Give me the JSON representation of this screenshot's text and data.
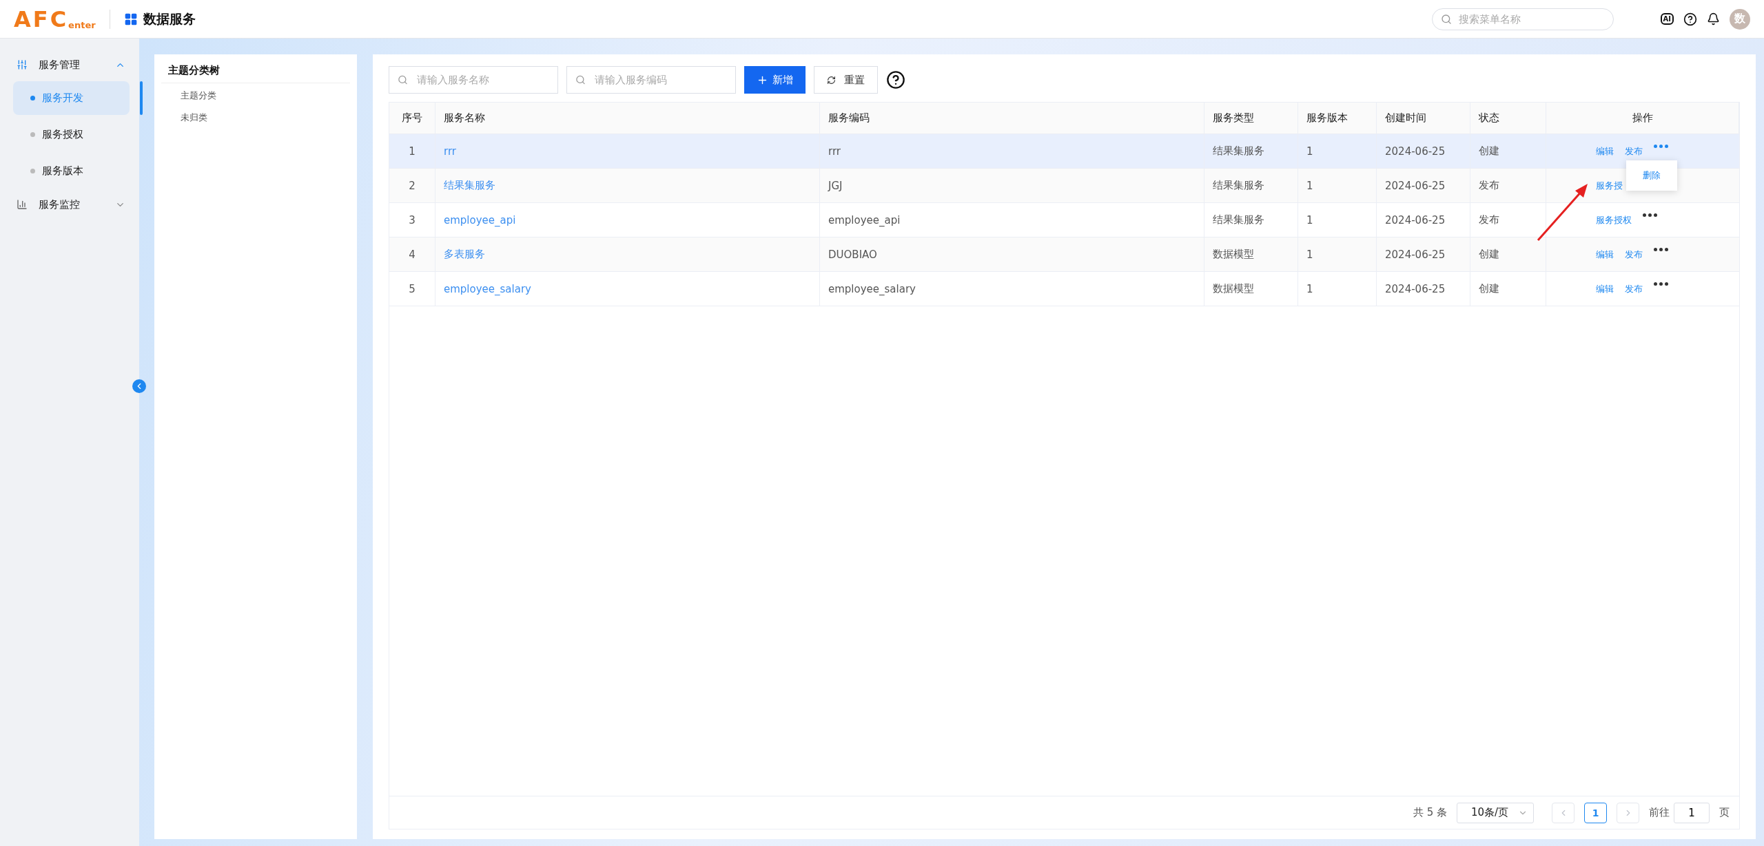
{
  "header": {
    "logo_main": "AFC",
    "logo_sub": "enter",
    "app_title": "数据服务",
    "search": {
      "placeholder": "搜索菜单名称"
    },
    "ai_badge": "AI",
    "avatar": "数"
  },
  "sidebar": {
    "items": [
      {
        "label": "服务管理",
        "expanded": true,
        "children": [
          {
            "label": "服务开发",
            "selected": true
          },
          {
            "label": "服务授权",
            "selected": false
          },
          {
            "label": "服务版本",
            "selected": false
          }
        ]
      },
      {
        "label": "服务监控",
        "expanded": false
      }
    ]
  },
  "tree": {
    "title": "主题分类树",
    "items": [
      {
        "label": "主题分类"
      },
      {
        "label": "未归类"
      }
    ]
  },
  "toolbar": {
    "name_search": {
      "placeholder": "请输入服务名称"
    },
    "code_search": {
      "placeholder": "请输入服务编码"
    },
    "add_button": "新增",
    "reset_button": "重置"
  },
  "table": {
    "columns": [
      "序号",
      "服务名称",
      "服务编码",
      "服务类型",
      "服务版本",
      "创建时间",
      "状态",
      "操作"
    ],
    "rows": [
      {
        "index": "1",
        "name": "rrr",
        "code": "rrr",
        "type": "结果集服务",
        "version": "1",
        "created": "2024-06-25",
        "status": "创建",
        "actions": [
          "编辑",
          "发布"
        ],
        "more_open": true,
        "hovered": true,
        "menu": [
          "删除"
        ]
      },
      {
        "index": "2",
        "name": "结果集服务",
        "code": "JGJ",
        "type": "结果集服务",
        "version": "1",
        "created": "2024-06-25",
        "status": "发布",
        "actions": [
          "服务授"
        ],
        "hovered": false
      },
      {
        "index": "3",
        "name": "employee_api",
        "code": "employee_api",
        "type": "结果集服务",
        "version": "1",
        "created": "2024-06-25",
        "status": "发布",
        "actions": [
          "服务授权"
        ],
        "more_open": false,
        "hovered": false
      },
      {
        "index": "4",
        "name": "多表服务",
        "code": "DUOBIAO",
        "type": "数据模型",
        "version": "1",
        "created": "2024-06-25",
        "status": "创建",
        "actions": [
          "编辑",
          "发布"
        ],
        "more_open": false,
        "hovered": false
      },
      {
        "index": "5",
        "name": "employee_salary",
        "code": "employee_salary",
        "type": "数据模型",
        "version": "1",
        "created": "2024-06-25",
        "status": "创建",
        "actions": [
          "编辑",
          "发布"
        ],
        "more_open": false,
        "hovered": false
      }
    ]
  },
  "annotation_arrow": true,
  "pagination": {
    "total": "共 5 条",
    "page_size": "10条/页",
    "pages": [
      {
        "label": "1",
        "selected": true
      }
    ],
    "goto_label": "前往",
    "goto_value": "1",
    "goto_suffix": "页"
  }
}
